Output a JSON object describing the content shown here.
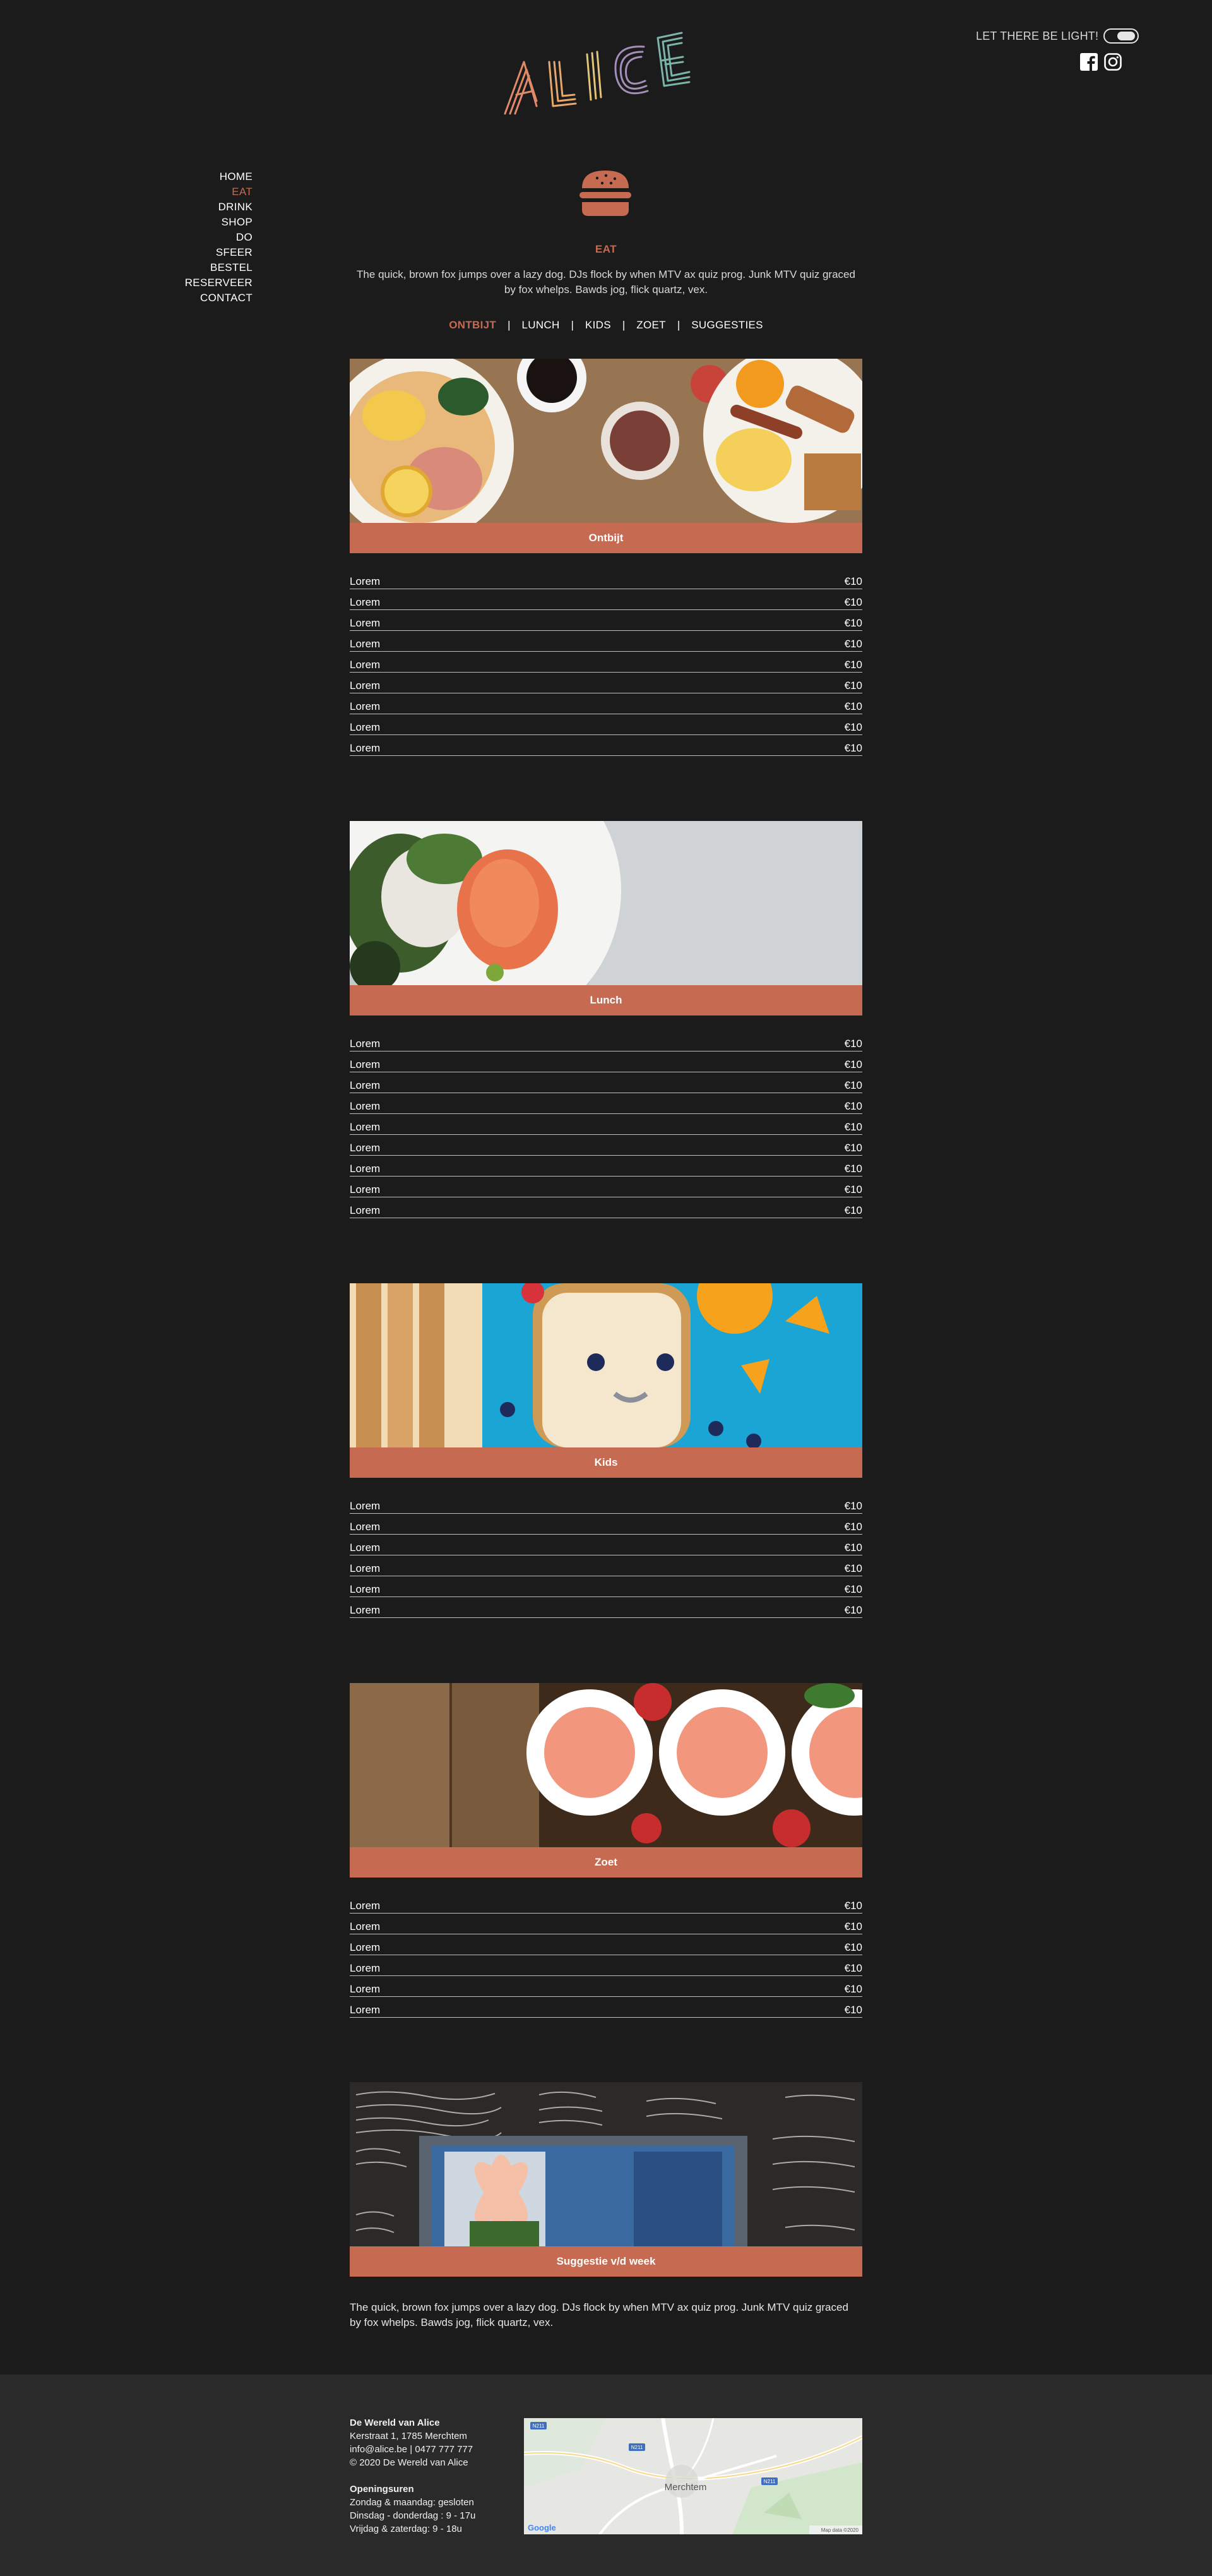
{
  "header": {
    "logo_text": "ALICE",
    "light_toggle_label": "LET THERE BE LIGHT!",
    "socials": [
      "facebook-icon",
      "instagram-icon"
    ]
  },
  "nav": {
    "items": [
      {
        "label": "HOME",
        "active": false
      },
      {
        "label": "EAT",
        "active": true
      },
      {
        "label": "DRINK",
        "active": false
      },
      {
        "label": "SHOP",
        "active": false
      },
      {
        "label": "DO",
        "active": false
      },
      {
        "label": "SFEER",
        "active": false
      },
      {
        "label": "BESTEL",
        "active": false
      },
      {
        "label": "RESERVEER",
        "active": false
      },
      {
        "label": "CONTACT",
        "active": false
      }
    ]
  },
  "page": {
    "icon": "burger-icon",
    "title": "EAT",
    "intro": "The quick, brown fox jumps over a lazy dog. DJs flock by when MTV ax quiz prog. Junk MTV quiz graced by fox whelps. Bawds jog, flick quartz, vex.",
    "tabs": [
      "ONTBIJT",
      "LUNCH",
      "KIDS",
      "ZOET",
      "SUGGESTIES"
    ],
    "active_tab": "ONTBIJT"
  },
  "colors": {
    "accent": "#c76a52",
    "background": "#1b1b1b",
    "footer": "#2a2a2a"
  },
  "sections": {
    "ontbijt": {
      "title": "Ontbijt",
      "items": [
        {
          "name": "Lorem",
          "price": "€10"
        },
        {
          "name": "Lorem",
          "price": "€10"
        },
        {
          "name": "Lorem",
          "price": "€10"
        },
        {
          "name": "Lorem",
          "price": "€10"
        },
        {
          "name": "Lorem",
          "price": "€10"
        },
        {
          "name": "Lorem",
          "price": "€10"
        },
        {
          "name": "Lorem",
          "price": "€10"
        },
        {
          "name": "Lorem",
          "price": "€10"
        },
        {
          "name": "Lorem",
          "price": "€10"
        }
      ]
    },
    "lunch": {
      "title": "Lunch",
      "items": [
        {
          "name": "Lorem",
          "price": "€10"
        },
        {
          "name": "Lorem",
          "price": "€10"
        },
        {
          "name": "Lorem",
          "price": "€10"
        },
        {
          "name": "Lorem",
          "price": "€10"
        },
        {
          "name": "Lorem",
          "price": "€10"
        },
        {
          "name": "Lorem",
          "price": "€10"
        },
        {
          "name": "Lorem",
          "price": "€10"
        },
        {
          "name": "Lorem",
          "price": "€10"
        },
        {
          "name": "Lorem",
          "price": "€10"
        }
      ]
    },
    "kids": {
      "title": "Kids",
      "items": [
        {
          "name": "Lorem",
          "price": "€10"
        },
        {
          "name": "Lorem",
          "price": "€10"
        },
        {
          "name": "Lorem",
          "price": "€10"
        },
        {
          "name": "Lorem",
          "price": "€10"
        },
        {
          "name": "Lorem",
          "price": "€10"
        },
        {
          "name": "Lorem",
          "price": "€10"
        }
      ]
    },
    "zoet": {
      "title": "Zoet",
      "items": [
        {
          "name": "Lorem",
          "price": "€10"
        },
        {
          "name": "Lorem",
          "price": "€10"
        },
        {
          "name": "Lorem",
          "price": "€10"
        },
        {
          "name": "Lorem",
          "price": "€10"
        },
        {
          "name": "Lorem",
          "price": "€10"
        },
        {
          "name": "Lorem",
          "price": "€10"
        }
      ]
    },
    "suggestie": {
      "title": "Suggestie v/d week",
      "text": "The quick, brown fox jumps over a lazy dog. DJs flock by when MTV ax quiz prog. Junk MTV quiz graced by fox whelps. Bawds jog, flick quartz, vex."
    }
  },
  "footer": {
    "name": "De Wereld van Alice",
    "address": "Kerstraat 1, 1785 Merchtem",
    "contact": "info@alice.be | 0477 777 777",
    "copyright": "© 2020 De Wereld van Alice",
    "hours_title": "Openingsuren",
    "hours": [
      "Zondag & maandag: gesloten",
      "Dinsdag - donderdag : 9 - 17u",
      "Vrijdag & zaterdag: 9 - 18u"
    ],
    "map": {
      "place": "Merchtem",
      "road_labels": [
        "N211",
        "N211",
        "N211"
      ],
      "google": "Google",
      "attribution": "Map data ©2020"
    }
  }
}
